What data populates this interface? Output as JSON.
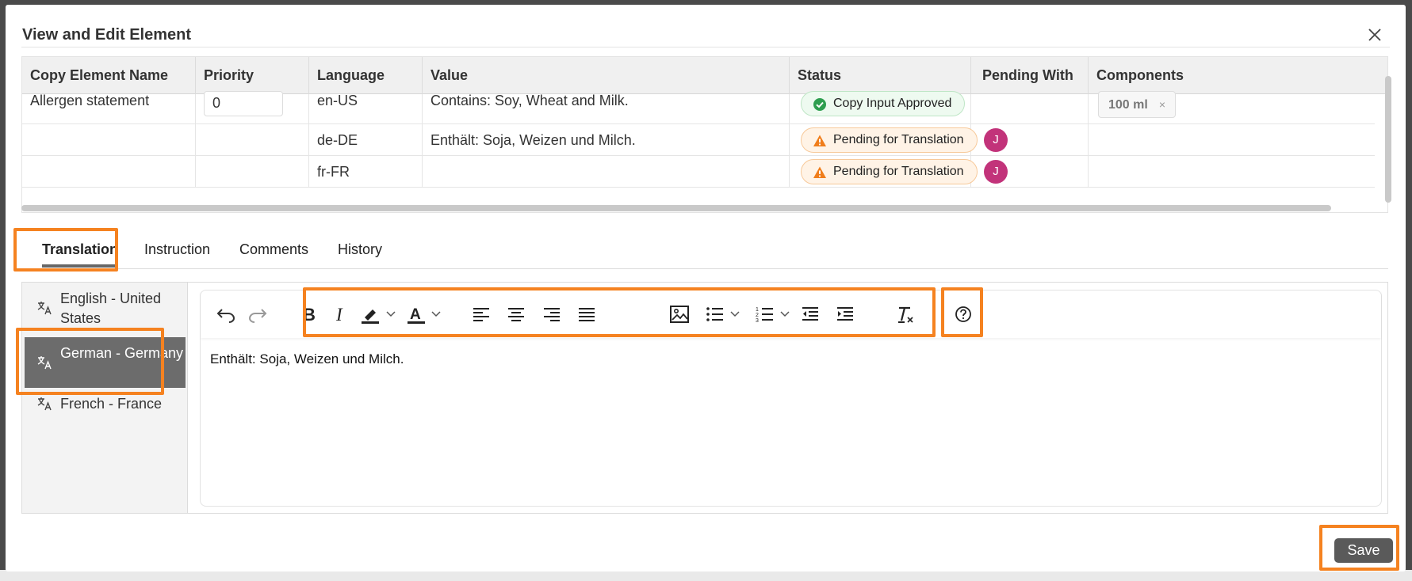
{
  "dialog": {
    "title": "View and Edit Element",
    "close_label": "×"
  },
  "table": {
    "headers": [
      "Copy Element Name",
      "Priority",
      "Language",
      "Value",
      "Status",
      "Pending With",
      "Components"
    ],
    "rows": [
      {
        "name": "Allergen statement",
        "priority": "0",
        "language": "en-US",
        "value": "Contains: Soy, Wheat and Milk.",
        "status": "Copy Input Approved",
        "status_type": "approved",
        "pending_with": "",
        "component": "100 ml"
      },
      {
        "name": "",
        "priority": "",
        "language": "de-DE",
        "value": "Enthält: Soja, Weizen und Milch.",
        "status": "Pending for Translation",
        "status_type": "pending",
        "pending_with": "J",
        "component": ""
      },
      {
        "name": "",
        "priority": "",
        "language": "fr-FR",
        "value": "",
        "status": "Pending for Translation",
        "status_type": "pending",
        "pending_with": "J",
        "component": ""
      }
    ],
    "chip_remove": "×"
  },
  "tabs": [
    "Translation",
    "Instruction",
    "Comments",
    "History"
  ],
  "active_tab": "Translation",
  "languages": [
    {
      "label": "English - United States"
    },
    {
      "label": "German - Germany"
    },
    {
      "label": "French - France"
    }
  ],
  "active_language": "German - Germany",
  "editor": {
    "content": "Enthält: Soja, Weizen und Milch.",
    "toolbar": [
      "undo-icon",
      "redo-icon",
      "bold-icon",
      "italic-icon",
      "highlight-icon",
      "font-color-icon",
      "align-left-icon",
      "align-center-icon",
      "align-right-icon",
      "align-justify-icon",
      "image-icon",
      "bullet-list-icon",
      "numbered-list-icon",
      "outdent-icon",
      "indent-icon",
      "clear-format-icon",
      "help-icon"
    ]
  },
  "save_label": "Save",
  "colors": {
    "highlight": "#f58220",
    "avatar": "#c2337a",
    "approved": "#2e9e4f",
    "pending": "#f07d1a",
    "active_lang_bg": "#6c6c6c"
  }
}
